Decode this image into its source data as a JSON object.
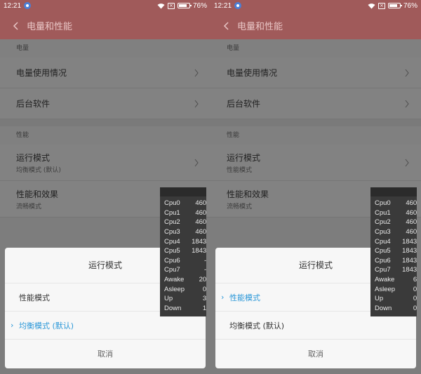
{
  "panels": [
    {
      "status": {
        "time": "12:21",
        "battery": "76%",
        "battery_fraction": 0.76
      },
      "header": {
        "title": "电量和性能"
      },
      "sections": {
        "power_label": "电量",
        "usage": "电量使用情况",
        "background": "后台软件",
        "perf_label": "性能",
        "run_mode": "运行模式",
        "run_mode_value": "均衡模式 (默认)",
        "effects": "性能和效果",
        "effects_value": "流畅模式"
      },
      "dialog": {
        "title": "运行模式",
        "options": [
          {
            "label": "性能模式",
            "selected": false
          },
          {
            "label": "均衡模式 (默认)",
            "selected": true
          }
        ],
        "cancel": "取消"
      },
      "cpu": [
        {
          "k": "Cpu0",
          "v": "460"
        },
        {
          "k": "Cpu1",
          "v": "460"
        },
        {
          "k": "Cpu2",
          "v": "460"
        },
        {
          "k": "Cpu3",
          "v": "460"
        },
        {
          "k": "Cpu4",
          "v": "1843"
        },
        {
          "k": "Cpu5",
          "v": "1843"
        },
        {
          "k": "Cpu6",
          "v": "-"
        },
        {
          "k": "Cpu7",
          "v": "-"
        },
        {
          "k": "Awake",
          "v": "20"
        },
        {
          "k": "Asleep",
          "v": "0"
        },
        {
          "k": "Up",
          "v": "3"
        },
        {
          "k": "Down",
          "v": "1"
        }
      ]
    },
    {
      "status": {
        "time": "12:21",
        "battery": "76%",
        "battery_fraction": 0.76
      },
      "header": {
        "title": "电量和性能"
      },
      "sections": {
        "power_label": "电量",
        "usage": "电量使用情况",
        "background": "后台软件",
        "perf_label": "性能",
        "run_mode": "运行模式",
        "run_mode_value": "性能模式",
        "effects": "性能和效果",
        "effects_value": "流畅模式"
      },
      "dialog": {
        "title": "运行模式",
        "options": [
          {
            "label": "性能模式",
            "selected": true
          },
          {
            "label": "均衡模式 (默认)",
            "selected": false
          }
        ],
        "cancel": "取消"
      },
      "cpu": [
        {
          "k": "Cpu0",
          "v": "460"
        },
        {
          "k": "Cpu1",
          "v": "460"
        },
        {
          "k": "Cpu2",
          "v": "460"
        },
        {
          "k": "Cpu3",
          "v": "460"
        },
        {
          "k": "Cpu4",
          "v": "1843"
        },
        {
          "k": "Cpu5",
          "v": "1843"
        },
        {
          "k": "Cpu6",
          "v": "1843"
        },
        {
          "k": "Cpu7",
          "v": "1843"
        },
        {
          "k": "Awake",
          "v": "6"
        },
        {
          "k": "Asleep",
          "v": "0"
        },
        {
          "k": "Up",
          "v": "0"
        },
        {
          "k": "Down",
          "v": "0"
        }
      ]
    }
  ],
  "colors": {
    "header": "#a05a5a",
    "accent": "#2a97d8"
  },
  "icons": {
    "back": "chevron-left-icon",
    "row": "chevron-right-icon",
    "check": "chevron-right-icon",
    "wifi": "wifi-icon",
    "sim": "no-sim-icon",
    "battery": "battery-icon",
    "notif": "notification-icon"
  }
}
